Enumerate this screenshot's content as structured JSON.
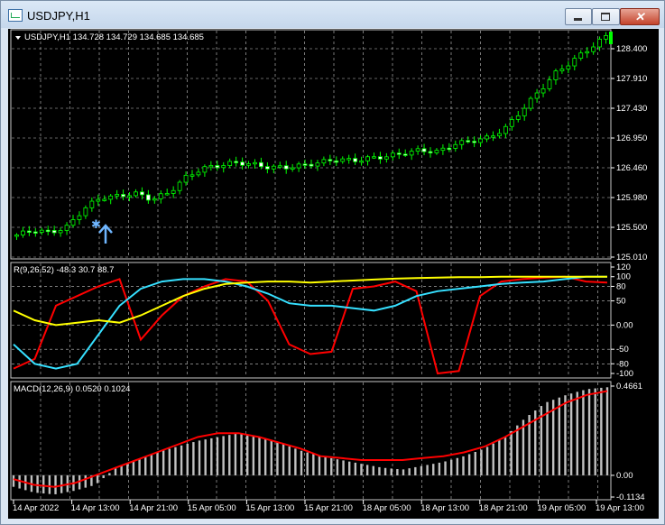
{
  "window": {
    "title": "USDJPY,H1",
    "buttons": [
      "minimize",
      "maximize",
      "close"
    ],
    "close_glyph": "✕"
  },
  "colors": {
    "background": "#000000",
    "grid": "#c8c8c8",
    "bull": "#00ff00",
    "bear": "#ffffff",
    "red_line": "#ff0000",
    "cyan_line": "#36e0ff",
    "yellow_line": "#ffff00",
    "macd_hist": "#c0c0c0",
    "signal": "#ff0000",
    "arrow": "#6fb6ff"
  },
  "price_panel": {
    "header": "USDJPY,H1  134.728 134.729 134.685 134.685",
    "price_labels": [
      "128.400",
      "127.910",
      "127.430",
      "126.950",
      "126.460",
      "125.980",
      "125.500",
      "125.010"
    ],
    "ylim": [
      125.01,
      128.4
    ]
  },
  "indicator_panel": {
    "header": "R(9,26,52) -48.3 30.7 88.7",
    "ticks": [
      "120",
      "100",
      "80",
      "50",
      "0.00",
      "-50",
      "-80",
      "-100"
    ]
  },
  "macd_panel": {
    "header": "MACD(12,26,9) 0.0520 0.1024",
    "ticks": [
      "0.4661",
      "0.00",
      "-0.1134"
    ]
  },
  "x_labels": [
    "14 Apr 2022",
    "14 Apr 13:00",
    "14 Apr 21:00",
    "15 Apr 05:00",
    "15 Apr 13:00",
    "15 Apr 21:00",
    "18 Apr 05:00",
    "18 Apr 13:00",
    "18 Apr 21:00",
    "19 Apr 05:00",
    "19 Apr 13:00"
  ],
  "chart_data": [
    {
      "type": "candlestick",
      "symbol": "USDJPY",
      "timeframe": "H1",
      "ylim": [
        125.01,
        128.4
      ],
      "close_path": [
        125.37,
        125.45,
        125.41,
        125.5,
        125.8,
        125.98,
        126.0,
        126.05,
        125.95,
        126.05,
        126.3,
        126.45,
        126.5,
        126.55,
        126.52,
        126.47,
        126.47,
        126.5,
        126.55,
        126.6,
        126.58,
        126.62,
        126.65,
        126.7,
        126.75,
        126.72,
        126.85,
        126.9,
        126.95,
        127.1,
        127.4,
        127.7,
        128.0,
        128.2,
        128.4,
        128.6
      ],
      "markers": [
        {
          "kind": "buy-arrow",
          "price": 125.45
        }
      ]
    },
    {
      "type": "line",
      "title": "R(9,26,52)",
      "series": [
        {
          "name": "-48.3",
          "color": "#ff0000",
          "values": [
            -90,
            -70,
            40,
            60,
            80,
            95,
            -30,
            20,
            60,
            80,
            95,
            90,
            50,
            -40,
            -60,
            -55,
            75,
            80,
            90,
            70,
            -100,
            -95,
            60,
            90,
            95,
            98,
            100,
            90,
            88
          ]
        },
        {
          "name": "30.7",
          "color": "#36e0ff",
          "values": [
            -40,
            -80,
            -90,
            -80,
            -20,
            40,
            75,
            90,
            95,
            95,
            90,
            80,
            65,
            45,
            40,
            40,
            35,
            30,
            40,
            60,
            70,
            75,
            80,
            85,
            88,
            90,
            95,
            100,
            100
          ]
        },
        {
          "name": "88.7",
          "color": "#ffff00",
          "values": [
            30,
            10,
            0,
            5,
            10,
            5,
            20,
            40,
            60,
            75,
            85,
            88,
            90,
            90,
            88,
            90,
            92,
            94,
            96,
            97,
            98,
            99,
            99,
            100,
            100,
            100,
            100,
            100,
            100
          ]
        }
      ]
    },
    {
      "type": "bar",
      "title": "MACD(12,26,9)",
      "ylim": [
        -0.1134,
        0.4661
      ],
      "values": [
        -0.06,
        -0.09,
        -0.1,
        -0.08,
        -0.05,
        0.04,
        0.08,
        0.12,
        0.15,
        0.18,
        0.2,
        0.22,
        0.2,
        0.17,
        0.13,
        0.1,
        0.08,
        0.06,
        0.04,
        0.03,
        0.05,
        0.07,
        0.1,
        0.14,
        0.2,
        0.3,
        0.38,
        0.42,
        0.45,
        0.46
      ],
      "signal": [
        -0.02,
        -0.05,
        -0.06,
        -0.04,
        0.0,
        0.04,
        0.08,
        0.12,
        0.16,
        0.2,
        0.22,
        0.22,
        0.2,
        0.17,
        0.14,
        0.1,
        0.09,
        0.08,
        0.08,
        0.08,
        0.09,
        0.1,
        0.12,
        0.15,
        0.2,
        0.26,
        0.32,
        0.38,
        0.42,
        0.44
      ]
    }
  ]
}
